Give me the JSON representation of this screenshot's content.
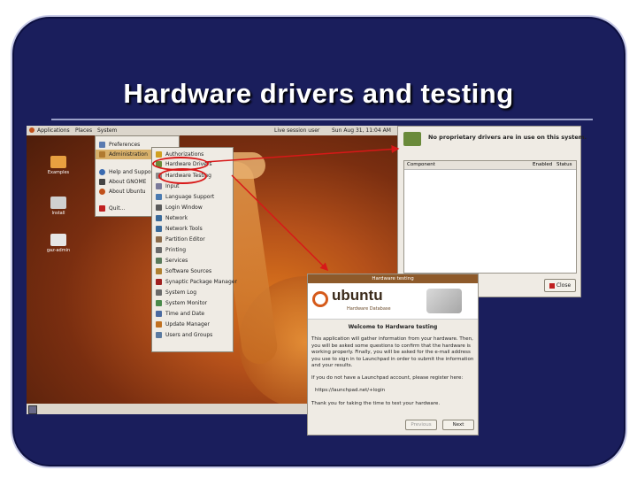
{
  "slide": {
    "title": "Hardware drivers and testing"
  },
  "panel": {
    "applications": "Applications",
    "places": "Places",
    "system": "System",
    "session": "Live session user",
    "clock": "Sun Aug 31, 11:04 AM"
  },
  "desktop_icons": [
    {
      "label": "Examples"
    },
    {
      "label": "Install"
    },
    {
      "label": "gaz-admin"
    }
  ],
  "system_menu": {
    "items": [
      "Preferences",
      "Administration",
      "Help and Support",
      "About GNOME",
      "About Ubuntu",
      "Quit..."
    ]
  },
  "admin_menu": {
    "items": [
      "Authorizations",
      "Hardware Drivers",
      "Hardware Testing",
      "Input",
      "Language Support",
      "Login Window",
      "Network",
      "Network Tools",
      "Partition Editor",
      "Printing",
      "Services",
      "Software Sources",
      "Synaptic Package Manager",
      "System Log",
      "System Monitor",
      "Time and Date",
      "Update Manager",
      "Users and Groups"
    ]
  },
  "drivers_window": {
    "message": "No proprietary drivers are in use on this system.",
    "col_component": "Component",
    "col_enabled": "Enabled",
    "col_status": "Status",
    "close": "Close"
  },
  "hw_testing": {
    "titlebar": "Hardware testing",
    "brand": "ubuntu",
    "brand_sub": "Hardware Database",
    "welcome": "Welcome to Hardware testing",
    "para1": "This application will gather information from your hardware. Then, you will be asked some questions to confirm that the hardware is working properly. Finally, you will be asked for the e-mail address you use to sign in to Launchpad in order to submit the information and your results.",
    "para2": "If you do not have a Launchpad account, please register here:",
    "link": "https://launchpad.net/+login",
    "para3": "Thank you for taking the time to test your hardware.",
    "previous": "Previous",
    "next": "Next"
  },
  "colors": {
    "frame": "#1a1e5c",
    "annotation": "#d81818",
    "menu_highlight": "#d8b06a"
  }
}
